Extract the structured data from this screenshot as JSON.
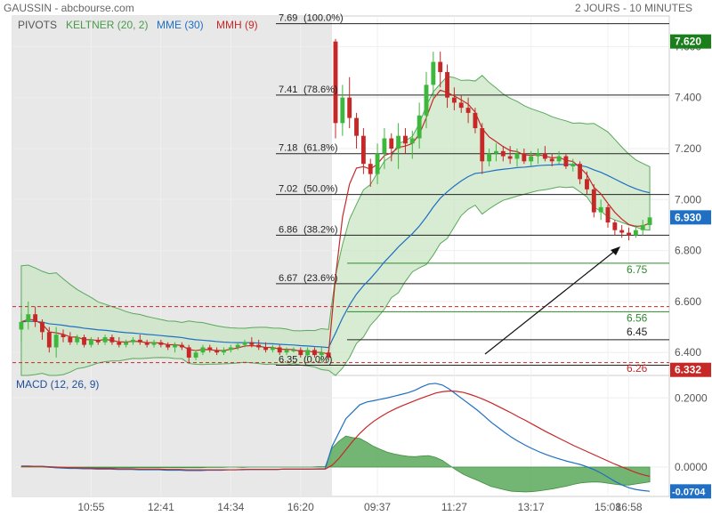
{
  "header": {
    "site": "GAUSSIN - abcbourse.com",
    "period": "2 JOURS - 10 MINUTES"
  },
  "legend": {
    "pivots": "PIVOTS",
    "keltner": "KELTNER (20, 2)",
    "mme": "MME (30)",
    "mmh": "MMH (9)",
    "macd": "MACD (12, 26, 9)"
  },
  "colors": {
    "up": "#3db83d",
    "down": "#c62828",
    "keltner": "#5aa85a",
    "keltner_fill": "#c9e6c3",
    "mme": "#1f6fc4",
    "mmh": "#c62828",
    "pivot_green": "#2e8b2e",
    "pivot_black": "#222222",
    "pivot_red": "#c62828",
    "price_badge": "#1a7f1a",
    "last_badge": "#1f6fc4",
    "low_badge": "#c62828",
    "shade": "#e8e8e8"
  },
  "chart_data": [
    {
      "type": "candlestick",
      "title": "GAUSSIN",
      "x_ticks": [
        "10:55",
        "12:41",
        "14:34",
        "16:20",
        "09:37",
        "11:27",
        "13:17",
        "15:08",
        "16:58"
      ],
      "y_ticks": [
        "7.600",
        "7.400",
        "7.200",
        "7.000",
        "6.800",
        "6.600",
        "6.400"
      ],
      "ylim": [
        6.31,
        7.72
      ],
      "fibonacci": [
        {
          "price": 7.69,
          "label": "7.69",
          "pct": "(100.0%)"
        },
        {
          "price": 7.41,
          "label": "7.41",
          "pct": "(78.6%)"
        },
        {
          "price": 7.18,
          "label": "7.18",
          "pct": "(61.8%)"
        },
        {
          "price": 7.02,
          "label": "7.02",
          "pct": "(50.0%)"
        },
        {
          "price": 6.86,
          "label": "6.86",
          "pct": "(38.2%)"
        },
        {
          "price": 6.67,
          "label": "6.67",
          "pct": "(23.6%)"
        },
        {
          "price": 6.35,
          "label": "6.35",
          "pct": "(0.0%)"
        }
      ],
      "pivots": [
        {
          "price": 6.75,
          "label": "6.75",
          "kind": "green"
        },
        {
          "price": 6.56,
          "label": "6.56",
          "kind": "green"
        },
        {
          "price": 6.45,
          "label": "6.45",
          "kind": "black"
        },
        {
          "price": 6.26,
          "label": "6.26",
          "kind": "red"
        }
      ],
      "prev_close_levels": [
        6.58,
        6.36
      ],
      "price_badges": [
        {
          "price": 7.62,
          "label": "7.620",
          "kind": "price"
        },
        {
          "price": 6.93,
          "label": "6.930",
          "kind": "last"
        },
        {
          "price": 6.332,
          "label": "6.332",
          "kind": "low"
        }
      ],
      "candles": [
        [
          6.49,
          6.55,
          6.44,
          6.52
        ],
        [
          6.52,
          6.6,
          6.49,
          6.55
        ],
        [
          6.55,
          6.58,
          6.5,
          6.52
        ],
        [
          6.52,
          6.53,
          6.45,
          6.48
        ],
        [
          6.48,
          6.5,
          6.4,
          6.42
        ],
        [
          6.42,
          6.5,
          6.38,
          6.47
        ],
        [
          6.47,
          6.49,
          6.44,
          6.46
        ],
        [
          6.46,
          6.48,
          6.43,
          6.44
        ],
        [
          6.44,
          6.47,
          6.43,
          6.46
        ],
        [
          6.46,
          6.47,
          6.42,
          6.43
        ],
        [
          6.43,
          6.46,
          6.42,
          6.45
        ],
        [
          6.45,
          6.46,
          6.43,
          6.44
        ],
        [
          6.44,
          6.47,
          6.43,
          6.46
        ],
        [
          6.46,
          6.47,
          6.43,
          6.44
        ],
        [
          6.44,
          6.46,
          6.42,
          6.43
        ],
        [
          6.43,
          6.45,
          6.42,
          6.44
        ],
        [
          6.44,
          6.46,
          6.43,
          6.45
        ],
        [
          6.45,
          6.47,
          6.43,
          6.44
        ],
        [
          6.44,
          6.45,
          6.42,
          6.43
        ],
        [
          6.43,
          6.45,
          6.42,
          6.44
        ],
        [
          6.44,
          6.45,
          6.42,
          6.43
        ],
        [
          6.43,
          6.44,
          6.41,
          6.42
        ],
        [
          6.42,
          6.44,
          6.4,
          6.43
        ],
        [
          6.43,
          6.44,
          6.41,
          6.42
        ],
        [
          6.42,
          6.43,
          6.36,
          6.38
        ],
        [
          6.38,
          6.41,
          6.37,
          6.4
        ],
        [
          6.4,
          6.43,
          6.39,
          6.42
        ],
        [
          6.42,
          6.43,
          6.4,
          6.41
        ],
        [
          6.41,
          6.42,
          6.39,
          6.4
        ],
        [
          6.4,
          6.42,
          6.39,
          6.41
        ],
        [
          6.41,
          6.43,
          6.4,
          6.42
        ],
        [
          6.42,
          6.44,
          6.41,
          6.43
        ],
        [
          6.43,
          6.45,
          6.42,
          6.44
        ],
        [
          6.44,
          6.46,
          6.42,
          6.43
        ],
        [
          6.43,
          6.45,
          6.41,
          6.42
        ],
        [
          6.42,
          6.44,
          6.4,
          6.41
        ],
        [
          6.41,
          6.43,
          6.4,
          6.42
        ],
        [
          6.42,
          6.43,
          6.39,
          6.4
        ],
        [
          6.4,
          6.42,
          6.39,
          6.41
        ],
        [
          6.41,
          6.42,
          6.4,
          6.41
        ],
        [
          6.41,
          6.42,
          6.38,
          6.39
        ],
        [
          6.39,
          6.42,
          6.38,
          6.41
        ],
        [
          6.41,
          6.42,
          6.38,
          6.39
        ],
        [
          6.39,
          6.42,
          6.36,
          6.4
        ],
        [
          6.4,
          6.41,
          6.37,
          6.38
        ],
        [
          7.62,
          7.63,
          7.24,
          7.3
        ],
        [
          7.3,
          7.45,
          7.25,
          7.4
        ],
        [
          7.4,
          7.48,
          7.28,
          7.32
        ],
        [
          7.32,
          7.34,
          7.2,
          7.25
        ],
        [
          7.25,
          7.28,
          7.1,
          7.14
        ],
        [
          7.14,
          7.16,
          7.05,
          7.1
        ],
        [
          7.1,
          7.22,
          7.06,
          7.18
        ],
        [
          7.18,
          7.28,
          7.12,
          7.24
        ],
        [
          7.24,
          7.26,
          7.15,
          7.2
        ],
        [
          7.2,
          7.3,
          7.12,
          7.25
        ],
        [
          7.25,
          7.28,
          7.18,
          7.22
        ],
        [
          7.22,
          7.27,
          7.16,
          7.24
        ],
        [
          7.24,
          7.38,
          7.2,
          7.33
        ],
        [
          7.33,
          7.5,
          7.28,
          7.45
        ],
        [
          7.45,
          7.58,
          7.4,
          7.54
        ],
        [
          7.54,
          7.58,
          7.44,
          7.5
        ],
        [
          7.5,
          7.53,
          7.36,
          7.4
        ],
        [
          7.4,
          7.44,
          7.35,
          7.38
        ],
        [
          7.38,
          7.41,
          7.34,
          7.36
        ],
        [
          7.36,
          7.4,
          7.3,
          7.34
        ],
        [
          7.34,
          7.36,
          7.26,
          7.28
        ],
        [
          7.28,
          7.3,
          7.1,
          7.15
        ],
        [
          7.15,
          7.2,
          7.13,
          7.18
        ],
        [
          7.18,
          7.22,
          7.15,
          7.19
        ],
        [
          7.19,
          7.21,
          7.15,
          7.17
        ],
        [
          7.17,
          7.21,
          7.14,
          7.16
        ],
        [
          7.16,
          7.2,
          7.13,
          7.18
        ],
        [
          7.18,
          7.2,
          7.14,
          7.15
        ],
        [
          7.15,
          7.19,
          7.13,
          7.17
        ],
        [
          7.17,
          7.2,
          7.14,
          7.18
        ],
        [
          7.18,
          7.21,
          7.15,
          7.16
        ],
        [
          7.16,
          7.18,
          7.13,
          7.15
        ],
        [
          7.15,
          7.19,
          7.14,
          7.17
        ],
        [
          7.17,
          7.18,
          7.12,
          7.13
        ],
        [
          7.13,
          7.16,
          7.11,
          7.14
        ],
        [
          7.14,
          7.15,
          7.06,
          7.08
        ],
        [
          7.08,
          7.11,
          7.02,
          7.04
        ],
        [
          7.04,
          7.06,
          6.93,
          6.95
        ],
        [
          6.95,
          7.0,
          6.92,
          6.97
        ],
        [
          6.97,
          6.98,
          6.89,
          6.91
        ],
        [
          6.91,
          6.92,
          6.86,
          6.88
        ],
        [
          6.88,
          6.9,
          6.85,
          6.87
        ],
        [
          6.87,
          6.89,
          6.84,
          6.86
        ],
        [
          6.86,
          6.9,
          6.85,
          6.88
        ],
        [
          6.88,
          6.92,
          6.86,
          6.9
        ],
        [
          6.9,
          6.93,
          6.88,
          6.93
        ]
      ]
    },
    {
      "type": "line",
      "title": "MACD (12, 26, 9)",
      "y_ticks": [
        "0.2000",
        "0.0000"
      ],
      "ylim": [
        -0.085,
        0.265
      ],
      "last_label": "-0.0704",
      "macd": [
        0.003,
        0.003,
        0.002,
        0.002,
        0.0,
        -0.002,
        -0.003,
        -0.004,
        -0.004,
        -0.005,
        -0.005,
        -0.006,
        -0.006,
        -0.006,
        -0.007,
        -0.007,
        -0.007,
        -0.008,
        -0.008,
        -0.008,
        -0.008,
        -0.009,
        -0.009,
        -0.009,
        -0.01,
        -0.01,
        -0.01,
        -0.009,
        -0.009,
        -0.009,
        -0.008,
        -0.008,
        -0.008,
        -0.007,
        -0.007,
        -0.007,
        -0.007,
        -0.007,
        -0.006,
        -0.006,
        -0.006,
        -0.006,
        -0.006,
        -0.005,
        -0.005,
        0.06,
        0.1,
        0.14,
        0.16,
        0.18,
        0.188,
        0.192,
        0.196,
        0.2,
        0.205,
        0.21,
        0.215,
        0.222,
        0.232,
        0.24,
        0.242,
        0.237,
        0.225,
        0.21,
        0.195,
        0.18,
        0.165,
        0.148,
        0.13,
        0.115,
        0.1,
        0.086,
        0.074,
        0.063,
        0.053,
        0.044,
        0.036,
        0.029,
        0.023,
        0.017,
        0.012,
        0.007,
        0.0,
        -0.008,
        -0.018,
        -0.03,
        -0.042,
        -0.052,
        -0.06,
        -0.065,
        -0.068,
        -0.07
      ],
      "signal": [
        0.002,
        0.002,
        0.002,
        0.002,
        0.001,
        0.0,
        -0.001,
        -0.002,
        -0.002,
        -0.003,
        -0.003,
        -0.004,
        -0.004,
        -0.004,
        -0.005,
        -0.005,
        -0.005,
        -0.006,
        -0.006,
        -0.006,
        -0.006,
        -0.007,
        -0.007,
        -0.007,
        -0.008,
        -0.008,
        -0.008,
        -0.008,
        -0.008,
        -0.008,
        -0.008,
        -0.008,
        -0.007,
        -0.007,
        -0.007,
        -0.007,
        -0.007,
        -0.007,
        -0.006,
        -0.006,
        -0.006,
        -0.006,
        -0.006,
        -0.006,
        -0.006,
        0.005,
        0.025,
        0.05,
        0.075,
        0.097,
        0.116,
        0.132,
        0.145,
        0.157,
        0.167,
        0.176,
        0.184,
        0.192,
        0.2,
        0.207,
        0.214,
        0.218,
        0.22,
        0.219,
        0.216,
        0.21,
        0.203,
        0.195,
        0.186,
        0.176,
        0.166,
        0.156,
        0.145,
        0.135,
        0.124,
        0.113,
        0.102,
        0.092,
        0.082,
        0.072,
        0.062,
        0.053,
        0.044,
        0.035,
        0.026,
        0.017,
        0.008,
        0.0,
        -0.008,
        -0.016,
        -0.022,
        -0.027
      ]
    }
  ]
}
